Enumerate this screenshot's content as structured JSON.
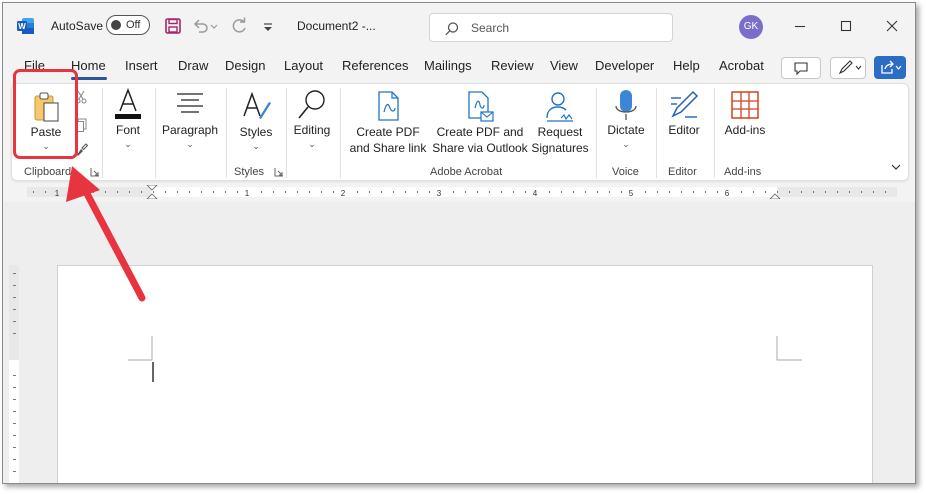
{
  "titlebar": {
    "autosave_label": "AutoSave",
    "autosave_state": "Off",
    "document_title": "Document2  -...",
    "search_placeholder": "Search",
    "user_initials": "GK"
  },
  "tabs": [
    "File",
    "Home",
    "Insert",
    "Draw",
    "Design",
    "Layout",
    "References",
    "Mailings",
    "Review",
    "View",
    "Developer",
    "Help",
    "Acrobat"
  ],
  "active_tab": "Home",
  "ribbon": {
    "paste": "Paste",
    "font": "Font",
    "paragraph": "Paragraph",
    "styles": "Styles",
    "editing": "Editing",
    "create_pdf_1": "Create PDF",
    "create_pdf_2": "and Share link",
    "create_pdf_outlook_1": "Create PDF and",
    "create_pdf_outlook_2": "Share via Outlook",
    "request_1": "Request",
    "request_2": "Signatures",
    "dictate": "Dictate",
    "editor": "Editor",
    "addins": "Add-ins"
  },
  "groups": {
    "clipboard": "Clipboard",
    "styles": "Styles",
    "adobe": "Adobe Acrobat",
    "voice": "Voice",
    "editor": "Editor",
    "addins": "Add-ins"
  },
  "ruler_numbers": [
    "1",
    "1",
    "2",
    "3",
    "4",
    "5",
    "6"
  ],
  "colors": {
    "accent": "#2b579a",
    "annotation_red": "#e8343f",
    "adobe_blue": "#1e73c8"
  }
}
